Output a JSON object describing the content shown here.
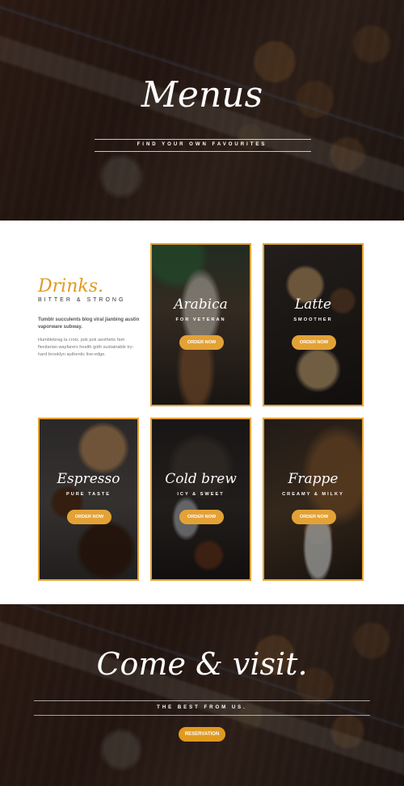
{
  "hero": {
    "title": "Menus",
    "subtitle": "FIND YOUR OWN FAVOURITES"
  },
  "intro": {
    "title": "Drinks.",
    "subtitle": "BITTER & STRONG",
    "lead": "Tumblr succulents blog viral jianbing austin vaporware subway.",
    "body": "Humblebrag la croix, pok pok aesthetic fam flexitarian wayfarers health goth sustainable try-hard brooklyn authentic live-edge."
  },
  "cards": [
    {
      "name": "Arabica",
      "tagline": "FOR VETERAN",
      "button": "ORDER NOW"
    },
    {
      "name": "Latte",
      "tagline": "SMOOTHER",
      "button": "ORDER NOW"
    },
    {
      "name": "Espresso",
      "tagline": "PURE TASTE",
      "button": "ORDER NOW"
    },
    {
      "name": "Cold brew",
      "tagline": "ICY & SWEET",
      "button": "ORDER NOW"
    },
    {
      "name": "Frappe",
      "tagline": "CREAMY & MILKY",
      "button": "ORDER NOW"
    }
  ],
  "footer": {
    "title": "Come & visit.",
    "subtitle": "THE BEST FROM US.",
    "button": "RESERVATION"
  },
  "colors": {
    "accent": "#e09a1f",
    "card_border": "#e3a236",
    "dark_overlay": "#2a1a15"
  }
}
